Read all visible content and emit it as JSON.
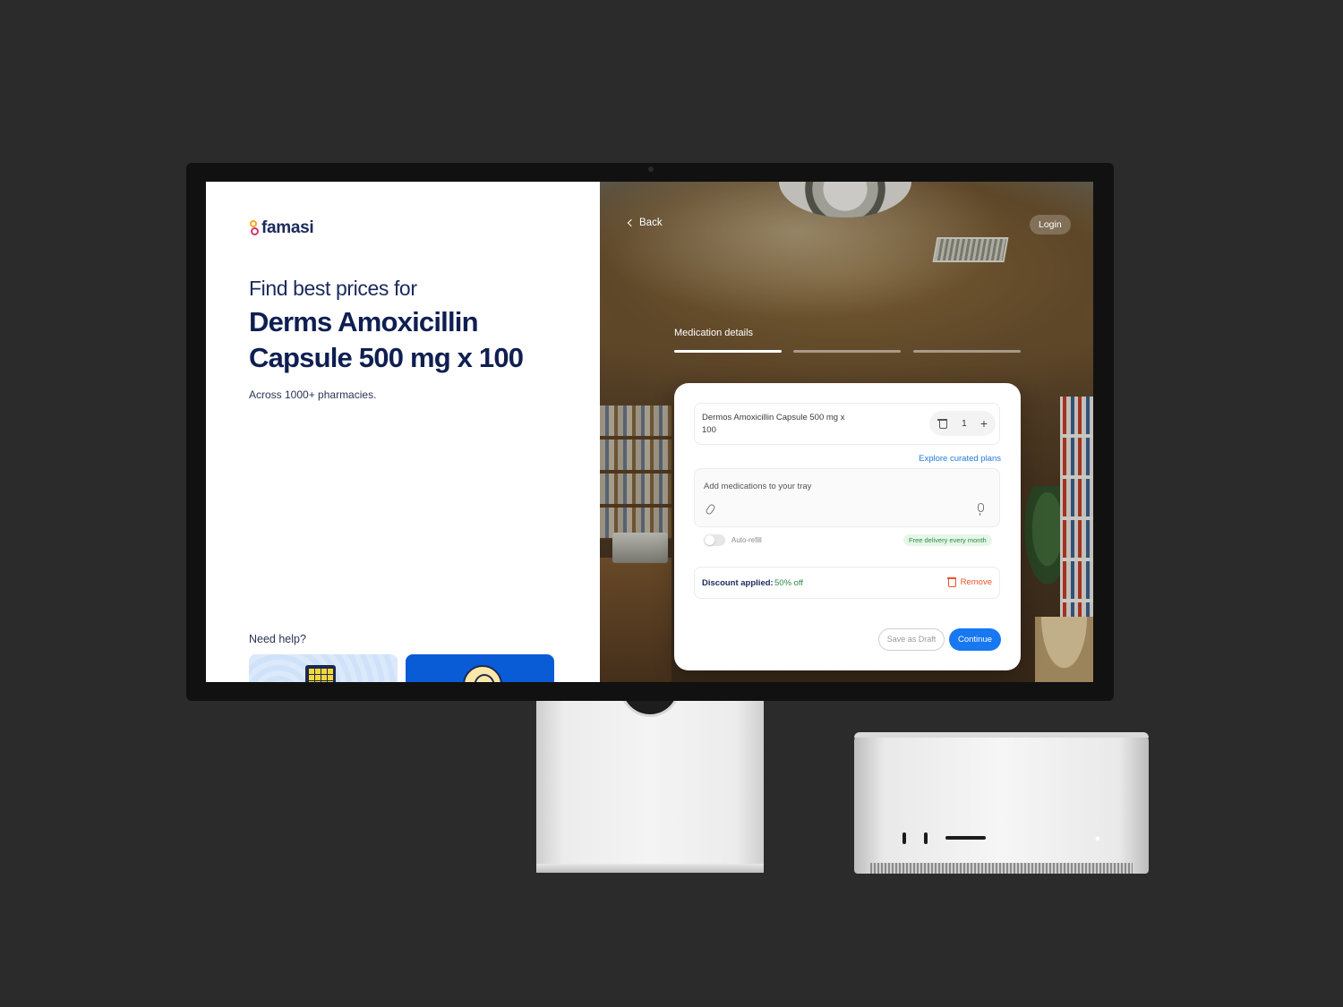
{
  "brand": {
    "name": "famasi"
  },
  "hero": {
    "subtitle": "Find best prices for",
    "title": "Derms Amoxicillin Capsule 500 mg x 100",
    "note": "Across 1000+ pharmacies."
  },
  "help": {
    "label": "Need help?"
  },
  "nav": {
    "back_label": "Back",
    "login_label": "Login"
  },
  "stepper": {
    "current_label": "Medication details",
    "steps_total": 3,
    "active_step": 1
  },
  "card": {
    "medication": {
      "name": "Dermos Amoxicillin Capsule 500 mg x 100",
      "quantity": "1"
    },
    "explore_link": "Explore curated plans",
    "tray": {
      "placeholder": "Add medications to your tray"
    },
    "auto_refill": {
      "label": "Auto-refill",
      "enabled": false
    },
    "delivery_badge": "Free delivery every month",
    "discount": {
      "label": "Discount applied:",
      "value": "50% off",
      "remove_label": "Remove"
    },
    "actions": {
      "draft_label": "Save as Draft",
      "continue_label": "Continue"
    }
  },
  "colors": {
    "accent": "#1778f2",
    "brand_navy": "#0f1f52",
    "success": "#2e8b43",
    "danger": "#e8542b"
  }
}
